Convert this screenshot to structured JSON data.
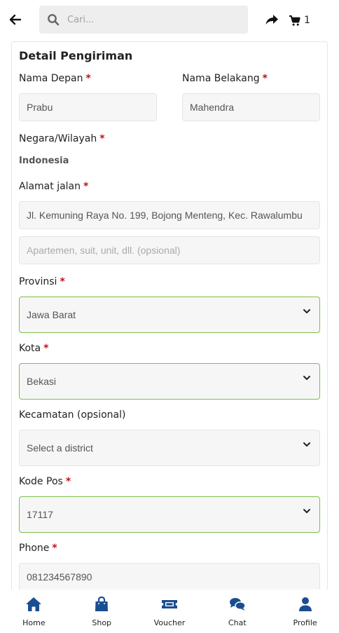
{
  "header": {
    "search_placeholder": "Cari...",
    "cart_count": "1"
  },
  "form": {
    "title": "Detail Pengiriman",
    "required_mark": "*",
    "first_name": {
      "label": "Nama Depan",
      "value": "Prabu"
    },
    "last_name": {
      "label": "Nama Belakang",
      "value": "Mahendra"
    },
    "country": {
      "label": "Negara/Wilayah",
      "value": "Indonesia"
    },
    "street": {
      "label": "Alamat jalan",
      "value": "Jl. Kemuning Raya No. 199, Bojong Menteng, Kec. Rawalumbu"
    },
    "apartment": {
      "placeholder": "Apartemen, suit, unit, dll. (opsional)"
    },
    "province": {
      "label": "Provinsi",
      "value": "Jawa Barat"
    },
    "city": {
      "label": "Kota",
      "value": "Bekasi"
    },
    "district": {
      "label": "Kecamatan (opsional)",
      "value": "Select a district"
    },
    "postal_code": {
      "label": "Kode Pos",
      "value": "17117"
    },
    "phone": {
      "label": "Phone",
      "value": "081234567890"
    }
  },
  "bottom_nav": [
    {
      "label": "Home",
      "icon": "home-icon"
    },
    {
      "label": "Shop",
      "icon": "shopping-bag-icon"
    },
    {
      "label": "Voucher",
      "icon": "ticket-icon"
    },
    {
      "label": "Chat",
      "icon": "chat-icon"
    },
    {
      "label": "Profile",
      "icon": "user-icon"
    }
  ],
  "colors": {
    "nav_icon": "#1b4e8f",
    "required": "#c0101a",
    "valid_border": "#7cc04b"
  }
}
